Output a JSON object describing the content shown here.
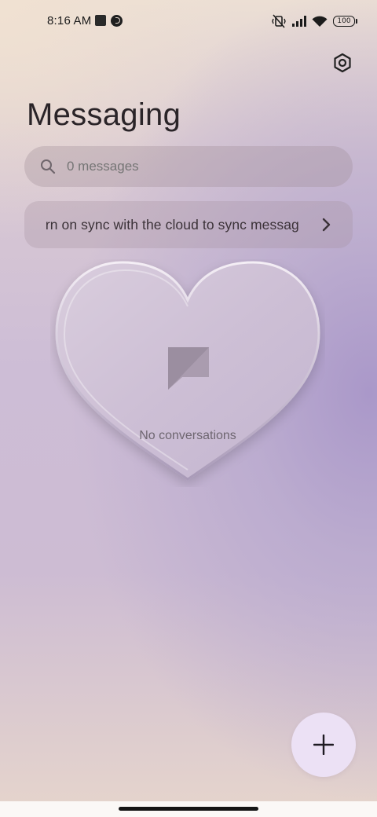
{
  "status_bar": {
    "time": "8:16 AM",
    "battery": "100"
  },
  "header": {
    "title": "Messaging"
  },
  "search": {
    "placeholder": "0 messages"
  },
  "sync_banner": {
    "text": "urn on sync with the cloud to sync messag"
  },
  "empty_state": {
    "text": "No conversations"
  },
  "icons": {
    "settings": "gear-icon",
    "search": "search-icon",
    "chevron": "chevron-right-icon",
    "chat": "chat-bubble-icon",
    "add": "plus-icon"
  },
  "colors": {
    "fab_background": "#ece1f5",
    "accent_purple": "#b3a3cb"
  }
}
